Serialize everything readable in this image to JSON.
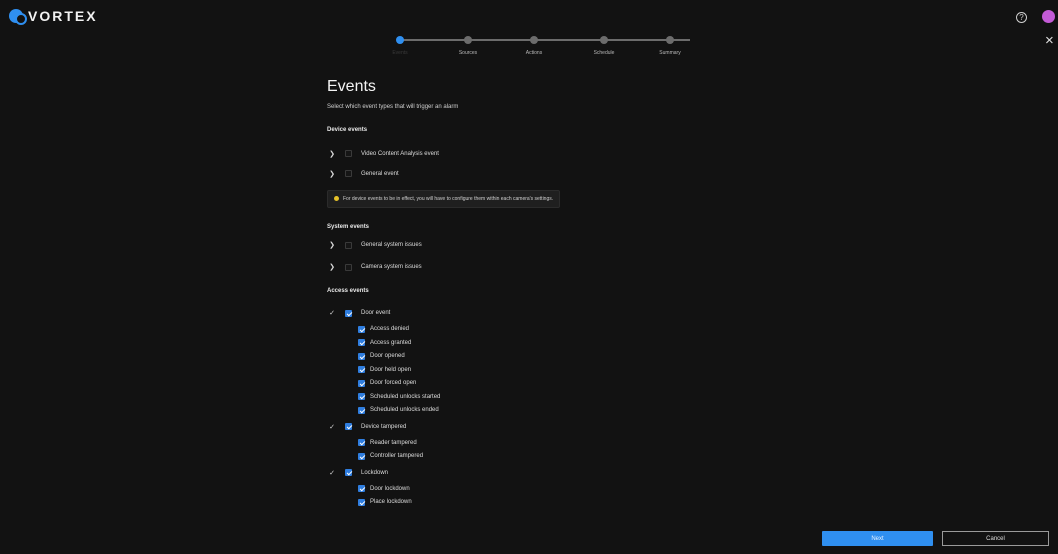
{
  "header": {
    "logo_text": "VORTEX",
    "help_glyph": "?",
    "close_glyph": "×",
    "accent": "#2f8ff0"
  },
  "stepper": {
    "steps": [
      {
        "label": "Events",
        "active": true
      },
      {
        "label": "Sources",
        "active": false
      },
      {
        "label": "Actions",
        "active": false
      },
      {
        "label": "Schedule",
        "active": false
      },
      {
        "label": "Summary",
        "active": false
      }
    ]
  },
  "main": {
    "title": "Events",
    "subtitle": "Select which event types that will trigger an alarm",
    "device_section": "Device events",
    "device_events": [
      {
        "label": "Video Content Analysis event"
      },
      {
        "label": "General event"
      }
    ],
    "notice": "For device events to be in effect, you will have to configure them within each camera's settings.",
    "system_section": "System events",
    "system_events": [
      {
        "label": "General system issues"
      },
      {
        "label": "Camera system issues"
      }
    ],
    "access_section": "Access events",
    "access_groups": [
      {
        "label": "Door event",
        "children": [
          "Access denied",
          "Access granted",
          "Door opened",
          "Door held open",
          "Door forced open",
          "Scheduled unlocks started",
          "Scheduled unlocks ended"
        ]
      },
      {
        "label": "Device tampered",
        "children": [
          "Reader tampered",
          "Controller tampered"
        ]
      },
      {
        "label": "Lockdown",
        "children": [
          "Door lockdown",
          "Place lockdown"
        ]
      }
    ]
  },
  "footer": {
    "next_label": "Next",
    "cancel_label": "Cancel"
  }
}
